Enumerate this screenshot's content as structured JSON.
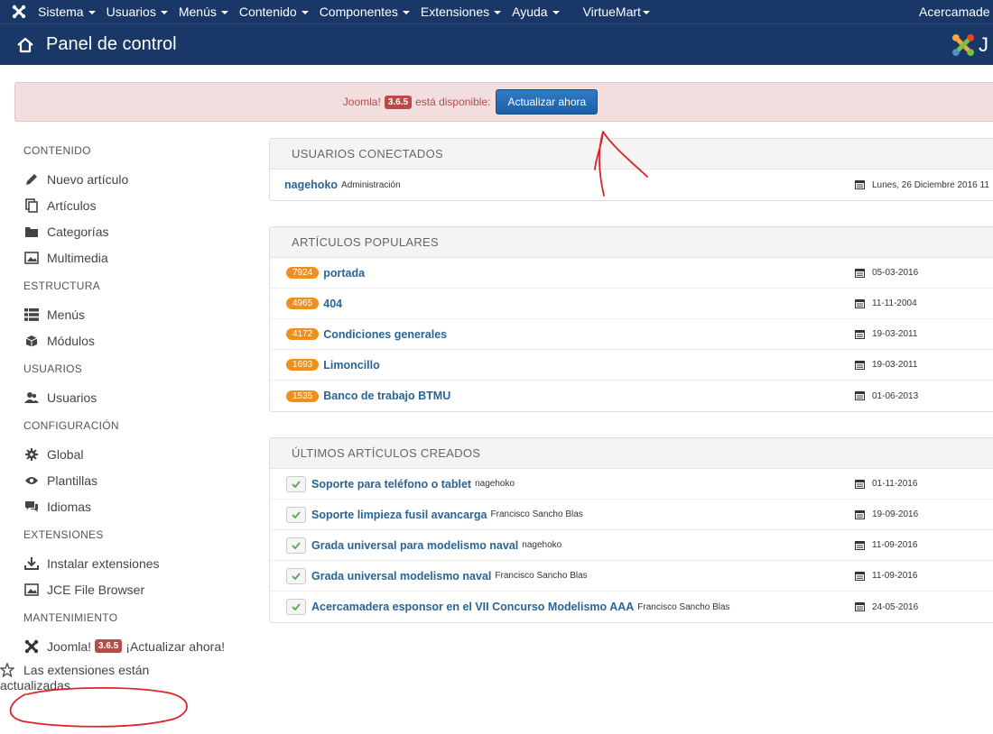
{
  "topnav": {
    "menus": [
      "Sistema",
      "Usuarios",
      "Menús",
      "Contenido",
      "Componentes",
      "Extensiones",
      "Ayuda",
      "VirtueMart"
    ],
    "site_name": "Acercamade"
  },
  "header": {
    "title": "Panel de control",
    "brand_partial": "J"
  },
  "alert": {
    "prefix": "Joomla!",
    "version": "3.6.5",
    "suffix": "está disponible:",
    "button_label": "Actualizar ahora"
  },
  "sidebar": {
    "sections": [
      {
        "heading": "CONTENIDO",
        "items": [
          {
            "label": "Nuevo artículo",
            "icon": "pencil-icon"
          },
          {
            "label": "Artículos",
            "icon": "stack-icon"
          },
          {
            "label": "Categorías",
            "icon": "folder-icon"
          },
          {
            "label": "Multimedia",
            "icon": "image-icon"
          }
        ]
      },
      {
        "heading": "ESTRUCTURA",
        "items": [
          {
            "label": "Menús",
            "icon": "list-icon"
          },
          {
            "label": "Módulos",
            "icon": "cube-icon"
          }
        ]
      },
      {
        "heading": "USUARIOS",
        "items": [
          {
            "label": "Usuarios",
            "icon": "users-icon"
          }
        ]
      },
      {
        "heading": "CONFIGURACIÓN",
        "items": [
          {
            "label": "Global",
            "icon": "gear-icon"
          },
          {
            "label": "Plantillas",
            "icon": "eye-icon"
          },
          {
            "label": "Idiomas",
            "icon": "comments-icon"
          }
        ]
      },
      {
        "heading": "EXTENSIONES",
        "items": [
          {
            "label": "Instalar extensiones",
            "icon": "download-icon"
          },
          {
            "label": "JCE File Browser",
            "icon": "image-icon"
          }
        ]
      }
    ],
    "maintenance": {
      "heading": "MANTENIMIENTO",
      "joomla_prefix": "Joomla!",
      "joomla_version": "3.6.5",
      "joomla_suffix": "¡Actualizar ahora!",
      "extensions_line1": "Las extensiones están",
      "extensions_line2": "actualizadas"
    }
  },
  "logged_users": {
    "title": "USUARIOS CONECTADOS",
    "rows": [
      {
        "name": "nagehoko",
        "role": "Administración",
        "date": "Lunes, 26 Diciembre 2016 11"
      }
    ]
  },
  "popular": {
    "title": "ARTÍCULOS POPULARES",
    "rows": [
      {
        "hits": "7924",
        "title": "portada",
        "date": "05-03-2016"
      },
      {
        "hits": "4965",
        "title": "404",
        "date": "11-11-2004"
      },
      {
        "hits": "4172",
        "title": "Condiciones generales",
        "date": "19-03-2011"
      },
      {
        "hits": "1693",
        "title": "Limoncillo",
        "date": "19-03-2011"
      },
      {
        "hits": "1535",
        "title": "Banco de trabajo BTMU",
        "date": "01-06-2013"
      }
    ]
  },
  "latest": {
    "title": "ÚLTIMOS ARTÍCULOS CREADOS",
    "rows": [
      {
        "title": "Soporte para teléfono o tablet",
        "author": "nagehoko",
        "date": "01-11-2016"
      },
      {
        "title": "Soporte limpieza fusil avancarga",
        "author": "Francisco Sancho Blas",
        "date": "19-09-2016"
      },
      {
        "title": "Grada universal para modelismo naval",
        "author": "nagehoko",
        "date": "11-09-2016"
      },
      {
        "title": "Grada universal modelismo naval",
        "author": "Francisco Sancho Blas",
        "date": "11-09-2016"
      },
      {
        "title": "Acercamadera esponsor en el VII Concurso Modelismo AAA",
        "author": "Francisco Sancho Blas",
        "date": "24-05-2016"
      }
    ]
  },
  "colors": {
    "navbar": "#1a3867",
    "alert_bg": "#f2dede",
    "badge_hits": "#f0901c",
    "link": "#2a6496",
    "annotation": "#e0202a"
  }
}
